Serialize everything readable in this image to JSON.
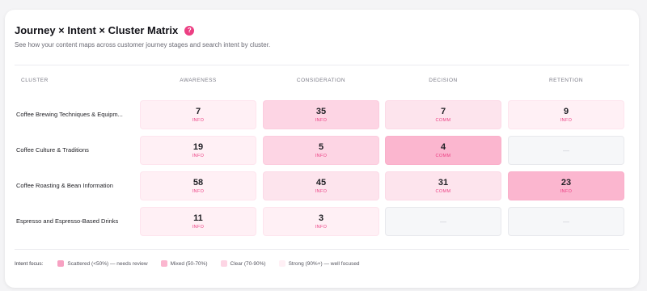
{
  "header": {
    "title": "Journey × Intent × Cluster Matrix",
    "help_icon": "?",
    "subtitle": "See how your content maps across customer journey stages and search intent by cluster."
  },
  "columns": {
    "cluster": "CLUSTER",
    "stages": [
      "AWARENESS",
      "CONSIDERATION",
      "DECISION",
      "RETENTION"
    ]
  },
  "rows": [
    {
      "label": "Coffee Brewing Techniques & Equipm...",
      "cells": [
        {
          "value": "7",
          "tag": "INFO",
          "level": 1
        },
        {
          "value": "35",
          "tag": "INFO",
          "level": 3
        },
        {
          "value": "7",
          "tag": "COMM",
          "level": 2
        },
        {
          "value": "9",
          "tag": "INFO",
          "level": 1
        }
      ]
    },
    {
      "label": "Coffee Culture & Traditions",
      "cells": [
        {
          "value": "19",
          "tag": "INFO",
          "level": 1
        },
        {
          "value": "5",
          "tag": "INFO",
          "level": 3
        },
        {
          "value": "4",
          "tag": "COMM",
          "level": 4
        },
        {
          "value": "—",
          "tag": "",
          "level": 0
        }
      ]
    },
    {
      "label": "Coffee Roasting & Bean Information",
      "cells": [
        {
          "value": "58",
          "tag": "INFO",
          "level": 1
        },
        {
          "value": "45",
          "tag": "INFO",
          "level": 2
        },
        {
          "value": "31",
          "tag": "COMM",
          "level": 2
        },
        {
          "value": "23",
          "tag": "INFO",
          "level": 4
        }
      ]
    },
    {
      "label": "Espresso and Espresso-Based Drinks",
      "cells": [
        {
          "value": "11",
          "tag": "INFO",
          "level": 1
        },
        {
          "value": "3",
          "tag": "INFO",
          "level": 1
        },
        {
          "value": "—",
          "tag": "",
          "level": 0
        },
        {
          "value": "—",
          "tag": "",
          "level": 0
        }
      ]
    }
  ],
  "legend": {
    "label": "Intent focus:",
    "items": [
      {
        "text": "Scattered (<50%) — needs review",
        "color": "#f7a1c2"
      },
      {
        "text": "Mixed (50-70%)",
        "color": "#fbb6cf"
      },
      {
        "text": "Clear (70-90%)",
        "color": "#fdd5e4"
      },
      {
        "text": "Strong (90%+) — well focused",
        "color": "#fff0f5"
      }
    ]
  },
  "colors": {
    "accent": "#ec3f83"
  }
}
